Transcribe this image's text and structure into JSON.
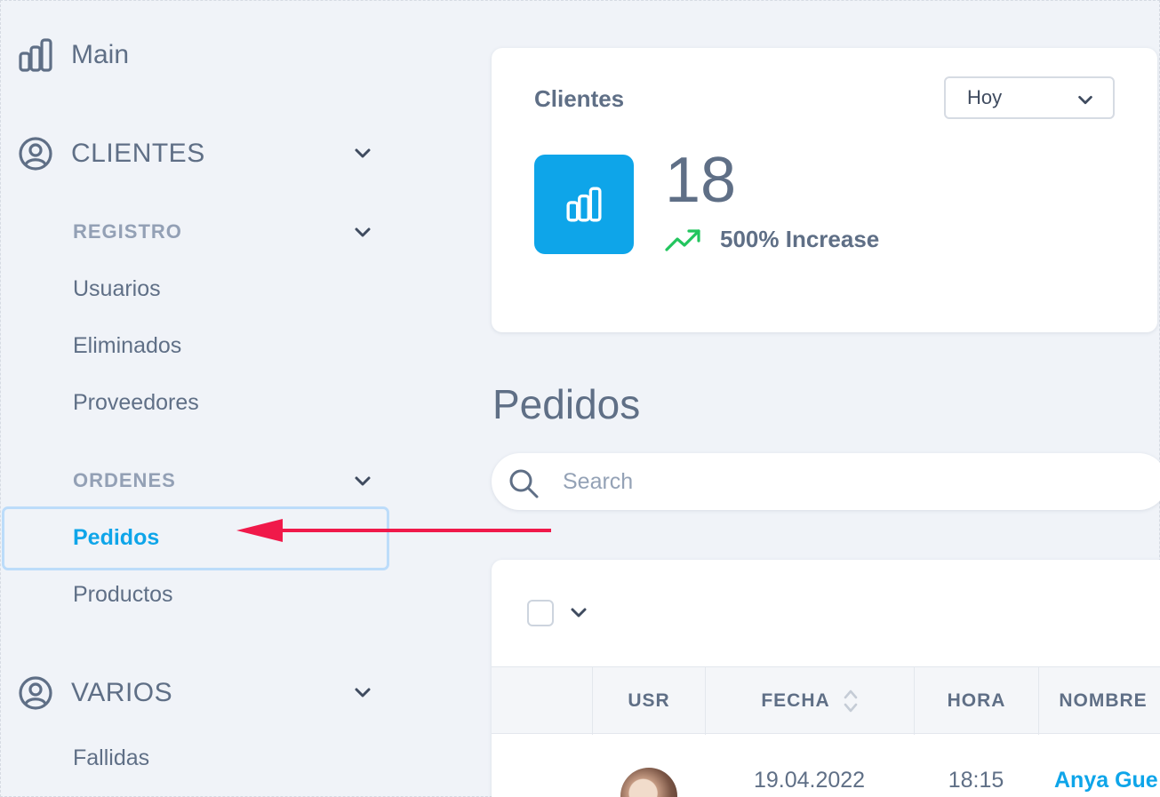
{
  "sidebar": {
    "main_label": "Main",
    "clientes_label": "CLIENTES",
    "registro_label": "REGISTRO",
    "registro_items": [
      "Usuarios",
      "Eliminados",
      "Proveedores"
    ],
    "ordenes_label": "ORDENES",
    "ordenes_items": [
      "Pedidos",
      "Productos"
    ],
    "varios_label": "VARIOS",
    "varios_items": [
      "Fallidas"
    ],
    "active_item": "Pedidos"
  },
  "stat_card": {
    "title": "Clientes",
    "period_select": "Hoy",
    "value": "18",
    "trend_text": "500% Increase",
    "trend_color": "#22c55e",
    "icon": "bar-chart-icon",
    "accent": "#0ea5e9"
  },
  "page": {
    "title": "Pedidos"
  },
  "search": {
    "placeholder": "Search",
    "value": ""
  },
  "table": {
    "columns": [
      "USR",
      "FECHA",
      "HORA",
      "NOMBRE"
    ],
    "rows": [
      {
        "date": "19.04.2022",
        "time": "18:15",
        "name": "Anya Gue"
      }
    ]
  }
}
